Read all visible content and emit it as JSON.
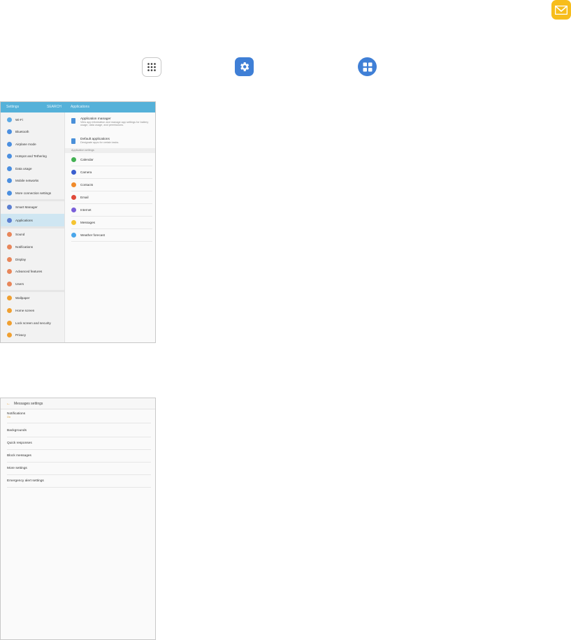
{
  "top_icons": {
    "email_icon": "email-icon",
    "apps_icon": "apps-icon",
    "settings_icon": "settings-icon",
    "applications_icon": "applications-icon"
  },
  "shot1": {
    "topbar": {
      "title": "Settings",
      "search": "SEARCH",
      "panel_title": "Applications"
    },
    "left_items": [
      {
        "label": "Wi-Fi",
        "color": "#5aa9e6"
      },
      {
        "label": "Bluetooth",
        "color": "#4b8fe0"
      },
      {
        "label": "Airplane mode",
        "color": "#4b8fe0"
      },
      {
        "label": "Hotspot and Tethering",
        "color": "#4b8fe0"
      },
      {
        "label": "Data usage",
        "color": "#4b8fe0"
      },
      {
        "label": "Mobile networks",
        "color": "#4b8fe0"
      },
      {
        "label": "More connection settings",
        "color": "#4b8fe0"
      },
      {
        "label": "Smart Manager",
        "color": "#5b7fd1"
      },
      {
        "label": "Applications",
        "color": "#5b7fd1"
      },
      {
        "label": "Sound",
        "color": "#e8865a"
      },
      {
        "label": "Notifications",
        "color": "#e8865a"
      },
      {
        "label": "Display",
        "color": "#e8865a"
      },
      {
        "label": "Advanced features",
        "color": "#e8865a"
      },
      {
        "label": "Users",
        "color": "#e8865a"
      },
      {
        "label": "Wallpaper",
        "color": "#f0a030"
      },
      {
        "label": "Home screen",
        "color": "#f0a030"
      },
      {
        "label": "Lock screen and security",
        "color": "#f0a030"
      },
      {
        "label": "Privacy",
        "color": "#f0a030"
      }
    ],
    "app_manager": {
      "title": "Application manager",
      "desc": "View app information and manage app settings for battery usage, data usage, and permissions."
    },
    "default_apps": {
      "title": "Default applications",
      "desc": "Designate apps for certain tasks."
    },
    "section_label": "Application settings",
    "apps": [
      {
        "label": "Calendar",
        "color": "#43b153"
      },
      {
        "label": "Camera",
        "color": "#3a5fcf"
      },
      {
        "label": "Contacts",
        "color": "#f08a2a"
      },
      {
        "label": "Email",
        "color": "#e04a3a"
      },
      {
        "label": "Internet",
        "color": "#7a5fd9"
      },
      {
        "label": "Messages",
        "color": "#f5c431"
      },
      {
        "label": "Weather forecast",
        "color": "#4aa6ea"
      }
    ]
  },
  "shot2": {
    "title": "Messages settings",
    "items": [
      {
        "label": "Notifications",
        "sub": "On"
      },
      {
        "label": "Backgrounds",
        "sub": ""
      },
      {
        "label": "Quick responses",
        "sub": ""
      },
      {
        "label": "Block messages",
        "sub": ""
      },
      {
        "label": "More settings",
        "sub": ""
      },
      {
        "label": "Emergency alert settings",
        "sub": ""
      }
    ]
  }
}
